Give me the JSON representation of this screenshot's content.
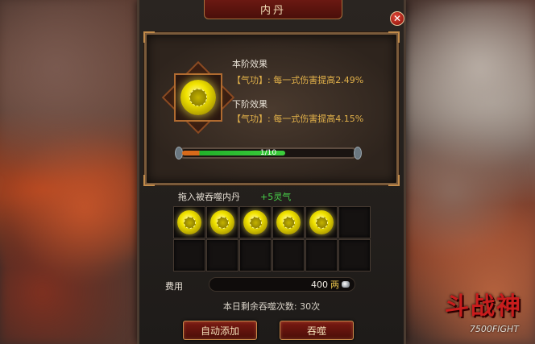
{
  "window": {
    "title": "内丹"
  },
  "effects": {
    "current_title": "本阶效果",
    "current_value": "【气功】: 每一式伤害提高2.49%",
    "next_title": "下阶效果",
    "next_value": "【气功】: 每一式伤害提高4.15%"
  },
  "progress": {
    "label": "1/10",
    "fraction": 0.1
  },
  "feed": {
    "label": "拖入被吞噬内丹",
    "bonus": "+5灵气",
    "slots": [
      {
        "filled": true
      },
      {
        "filled": true
      },
      {
        "filled": true
      },
      {
        "filled": true
      },
      {
        "filled": true
      },
      {
        "filled": false
      },
      {
        "filled": false
      },
      {
        "filled": false
      },
      {
        "filled": false
      },
      {
        "filled": false
      },
      {
        "filled": false
      },
      {
        "filled": false
      }
    ]
  },
  "cost": {
    "label": "费用",
    "value": "400",
    "unit": "两"
  },
  "remaining_text": "本日剩余吞噬次数: 30次",
  "buttons": {
    "auto_add": "自动添加",
    "devour": "吞噬"
  },
  "colors": {
    "effect_value": "#e3b24a",
    "bonus": "#49d24a",
    "pill": "#f2e400"
  }
}
